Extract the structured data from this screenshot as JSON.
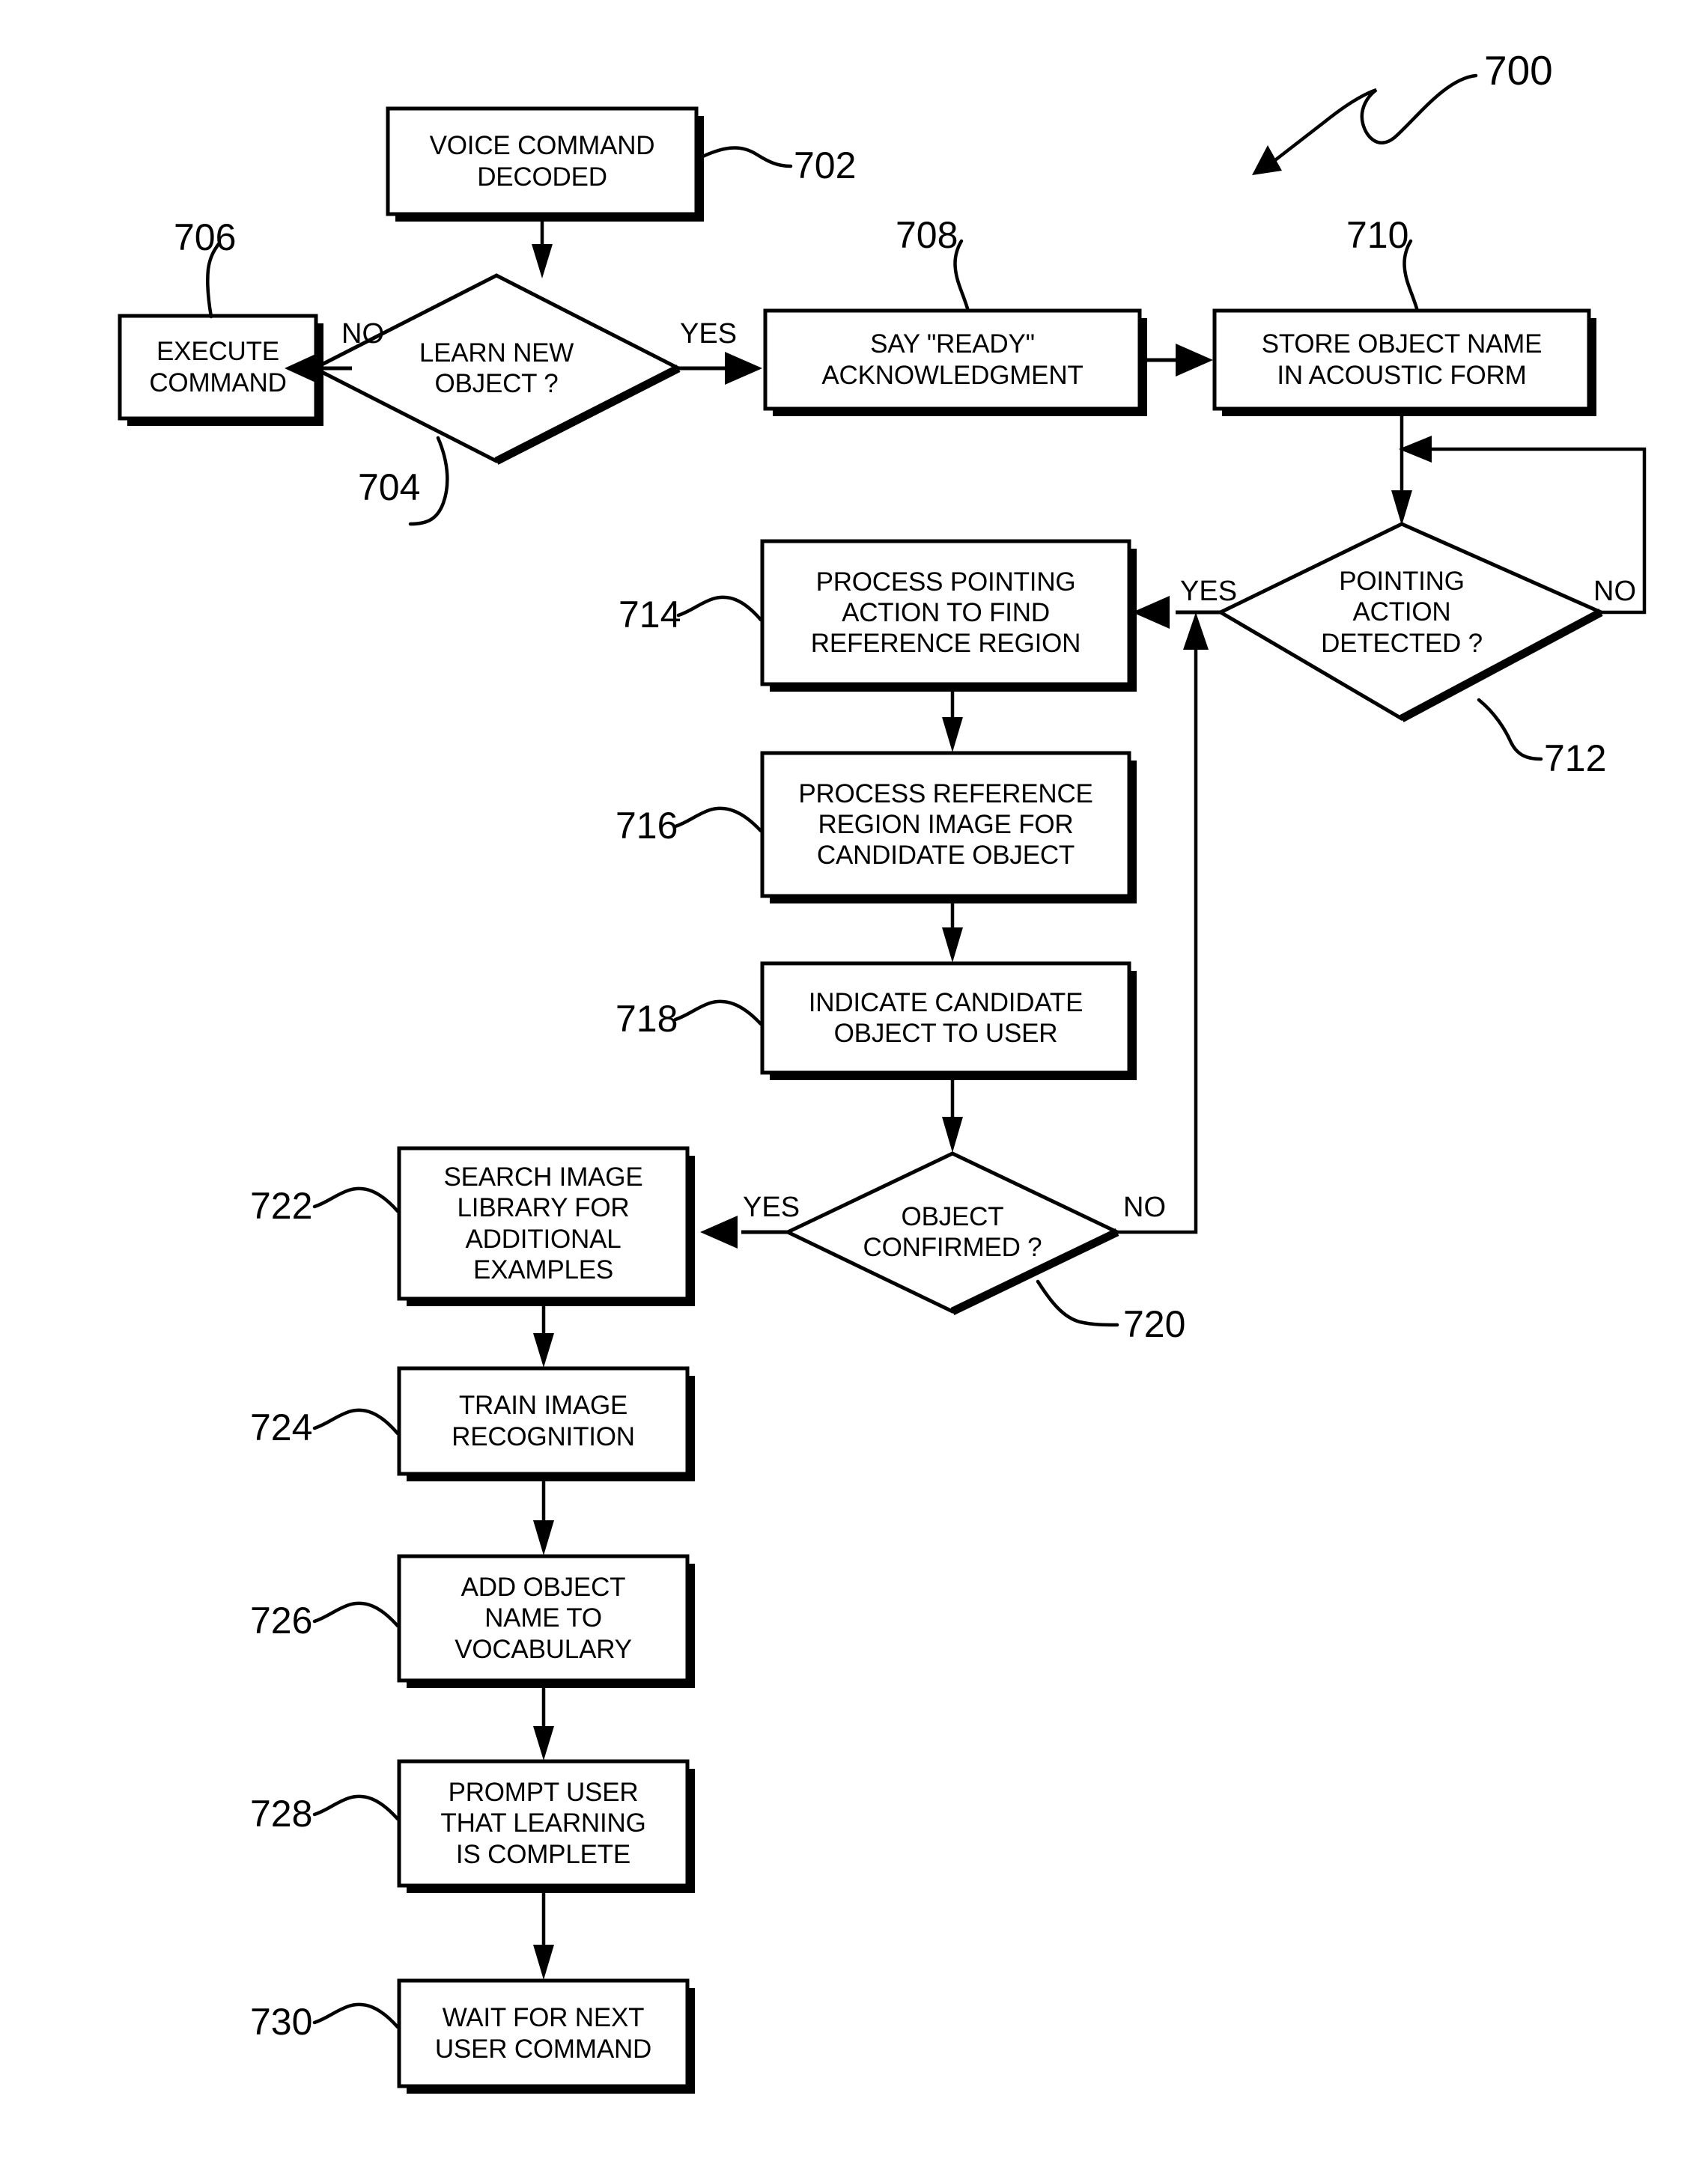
{
  "figure": {
    "number": "700"
  },
  "nodes": [
    {
      "id": "702",
      "ref": "702",
      "kind": "process",
      "text": "VOICE COMMAND\nDECODED"
    },
    {
      "id": "704",
      "ref": "704",
      "kind": "decision",
      "text": "LEARN NEW\nOBJECT ?"
    },
    {
      "id": "706",
      "ref": "706",
      "kind": "process",
      "text": "EXECUTE\nCOMMAND"
    },
    {
      "id": "708",
      "ref": "708",
      "kind": "process",
      "text": "SAY \"READY\"\nACKNOWLEDGMENT"
    },
    {
      "id": "710",
      "ref": "710",
      "kind": "process",
      "text": "STORE OBJECT NAME\nIN ACOUSTIC FORM"
    },
    {
      "id": "712",
      "ref": "712",
      "kind": "decision",
      "text": "POINTING\nACTION\nDETECTED ?"
    },
    {
      "id": "714",
      "ref": "714",
      "kind": "process",
      "text": "PROCESS POINTING\nACTION TO FIND\nREFERENCE REGION"
    },
    {
      "id": "716",
      "ref": "716",
      "kind": "process",
      "text": "PROCESS REFERENCE\nREGION IMAGE FOR\nCANDIDATE OBJECT"
    },
    {
      "id": "718",
      "ref": "718",
      "kind": "process",
      "text": "INDICATE CANDIDATE\nOBJECT TO USER"
    },
    {
      "id": "720",
      "ref": "720",
      "kind": "decision",
      "text": "OBJECT\nCONFIRMED ?"
    },
    {
      "id": "722",
      "ref": "722",
      "kind": "process",
      "text": "SEARCH IMAGE\nLIBRARY FOR\nADDITIONAL\nEXAMPLES"
    },
    {
      "id": "724",
      "ref": "724",
      "kind": "process",
      "text": "TRAIN IMAGE\nRECOGNITION"
    },
    {
      "id": "726",
      "ref": "726",
      "kind": "process",
      "text": "ADD OBJECT\nNAME TO\nVOCABULARY"
    },
    {
      "id": "728",
      "ref": "728",
      "kind": "process",
      "text": "PROMPT USER\nTHAT LEARNING\nIS COMPLETE"
    },
    {
      "id": "730",
      "ref": "730",
      "kind": "process",
      "text": "WAIT FOR NEXT\nUSER COMMAND"
    }
  ],
  "edge_labels": {
    "d704_no": "NO",
    "d704_yes": "YES",
    "d712_yes": "YES",
    "d712_no": "NO",
    "d720_yes": "YES",
    "d720_no": "NO"
  },
  "refs": {
    "r700": "700",
    "r702": "702",
    "r704": "704",
    "r706": "706",
    "r708": "708",
    "r710": "710",
    "r712": "712",
    "r714": "714",
    "r716": "716",
    "r718": "718",
    "r720": "720",
    "r722": "722",
    "r724": "724",
    "r726": "726",
    "r728": "728",
    "r730": "730"
  },
  "colors": {
    "ink": "#000000",
    "paper": "#ffffff"
  }
}
